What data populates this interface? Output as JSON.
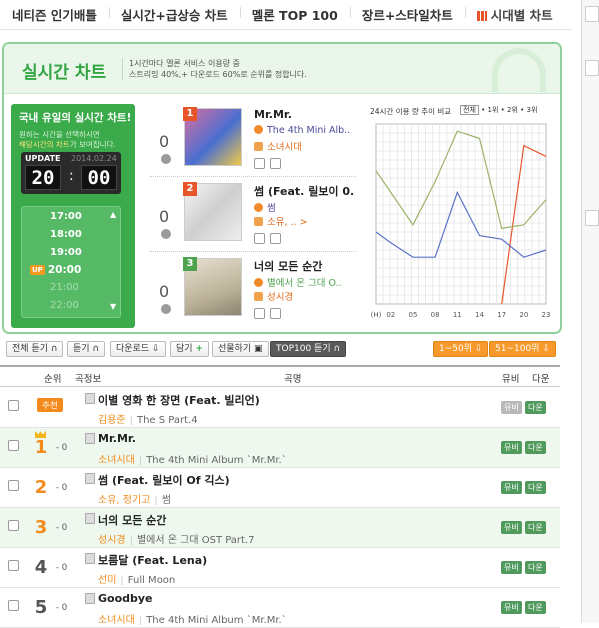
{
  "nav": {
    "items": [
      "네티즌 인기배틀",
      "실시간+급상승 차트",
      "멜론 TOP 100",
      "장르+스타일차트",
      "시대별 차트"
    ]
  },
  "panel": {
    "title": "실시간 차트",
    "desc_line1": "1시간마다 멜론 서비스 이용량 중",
    "desc_line2": "스트리밍 40%,+ 다운로드 60%로 순위를 정합니다."
  },
  "left": {
    "title": "국내 유일의 실시간 차트!",
    "desc1": "원하는 시간을 선택하시면",
    "desc2_hl": "해당시간의 차트",
    "desc2_rest": "가 보여집니다.",
    "update_label": "UPDATE",
    "date": "2014.02.24",
    "hour": "20",
    "minute": "00",
    "times": [
      "17:00",
      "18:00",
      "19:00",
      "20:00",
      "21:00",
      "22:00"
    ],
    "up_badge": "UP"
  },
  "chart_items": [
    {
      "num": "0",
      "rank": "1",
      "title": "Mr.Mr.",
      "album": "The 4th Mini Alb..",
      "artist": "소녀시대",
      "accent": "#e8552a"
    },
    {
      "num": "0",
      "rank": "2",
      "title": "썸 (Feat. 릴보이 0.",
      "album": "썸",
      "artist": "소유, .. >",
      "accent": "#e8552a"
    },
    {
      "num": "0",
      "rank": "3",
      "title": "너의 모든 순간",
      "album": "별에서 온 그대 O..",
      "artist": "성시경",
      "accent": "#4fa34f"
    }
  ],
  "graph": {
    "title": "24시간 이용 량 추이 비교",
    "legend": [
      "전체",
      "1위",
      "2위",
      "3위"
    ],
    "x_ticks": [
      "(H)",
      "02",
      "05",
      "08",
      "11",
      "14",
      "17",
      "20",
      "23"
    ]
  },
  "chart_data": {
    "type": "line",
    "title": "24시간 이용 량 추이 비교",
    "x": [
      0,
      2,
      5,
      8,
      11,
      14,
      17,
      20,
      23
    ],
    "x_tick_labels": [
      "(H)",
      "02",
      "05",
      "08",
      "11",
      "14",
      "17",
      "20",
      "23"
    ],
    "series": [
      {
        "name": "1위",
        "color": "#e8552a",
        "values": [
          null,
          null,
          null,
          null,
          null,
          null,
          0,
          88,
          82
        ]
      },
      {
        "name": "2위",
        "color": "#9cb36a",
        "values": [
          74,
          62,
          44,
          68,
          96,
          92,
          42,
          44,
          58
        ]
      },
      {
        "name": "3위",
        "color": "#5b72c6",
        "values": [
          40,
          34,
          26,
          26,
          62,
          38,
          36,
          26,
          30
        ]
      }
    ],
    "ylim": [
      0,
      100
    ],
    "grid": true,
    "legend": "top-right"
  },
  "toolbar": {
    "play_all": "전체 듣기",
    "play": "듣기",
    "download": "다운로드",
    "add": "담기",
    "gift": "선물하기",
    "top100": "TOP100 듣기",
    "range1": "1~50위",
    "range2": "51~100위"
  },
  "table": {
    "headers": {
      "rank": "순위",
      "info": "곡정보",
      "song": "곡명",
      "mv": "뮤비",
      "down": "다운"
    },
    "mv_label": "뮤비",
    "down_label": "다운",
    "rows": [
      {
        "rank": "추천",
        "change": "",
        "title": "이별 영화 한 장면 (Feat. 빌리언)",
        "artist": "김용준",
        "album": "The S Part.4",
        "mv": false
      },
      {
        "rank": "1",
        "change": "- 0",
        "title": "Mr.Mr.",
        "artist": "소녀시대",
        "album": "The 4th Mini Album `Mr.Mr.`",
        "mv": true
      },
      {
        "rank": "2",
        "change": "- 0",
        "title": "썸 (Feat. 릴보이 Of 긱스)",
        "artist": "소유, 정기고",
        "album": "썸",
        "mv": true
      },
      {
        "rank": "3",
        "change": "- 0",
        "title": "너의 모든 순간",
        "artist": "성시경",
        "album": "별에서 온 그대 OST Part.7",
        "mv": true
      },
      {
        "rank": "4",
        "change": "- 0",
        "title": "보름달 (Feat. Lena)",
        "artist": "선미",
        "album": "Full Moon",
        "mv": true
      },
      {
        "rank": "5",
        "change": "- 0",
        "title": "Goodbye",
        "artist": "소녀시대",
        "album": "The 4th Mini Album `Mr.Mr.`",
        "mv": true
      }
    ]
  }
}
